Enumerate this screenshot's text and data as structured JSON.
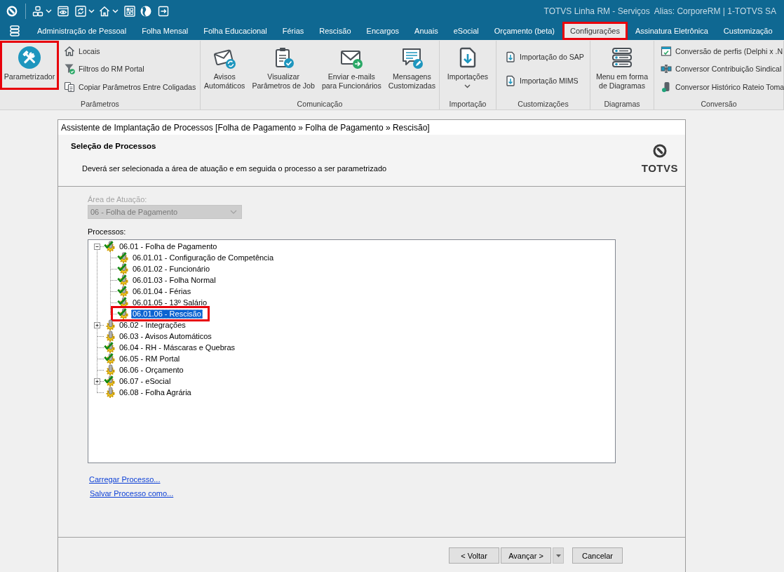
{
  "title_bar": {
    "text": "TOTVS Linha RM - Serviços  Alias: CorporeRM | 1-TOTVS SA"
  },
  "tabs": [
    {
      "label": "Administração de Pessoal",
      "selected": false,
      "highlighted": false
    },
    {
      "label": "Folha Mensal",
      "selected": false,
      "highlighted": false
    },
    {
      "label": "Folha Educacional",
      "selected": false,
      "highlighted": false
    },
    {
      "label": "Férias",
      "selected": false,
      "highlighted": false
    },
    {
      "label": "Rescisão",
      "selected": false,
      "highlighted": false
    },
    {
      "label": "Encargos",
      "selected": false,
      "highlighted": false
    },
    {
      "label": "Anuais",
      "selected": false,
      "highlighted": false
    },
    {
      "label": "eSocial",
      "selected": false,
      "highlighted": false
    },
    {
      "label": "Orçamento (beta)",
      "selected": false,
      "highlighted": false
    },
    {
      "label": "Configurações",
      "selected": true,
      "highlighted": true
    },
    {
      "label": "Assinatura Eletrônica",
      "selected": false,
      "highlighted": false
    },
    {
      "label": "Customização",
      "selected": false,
      "highlighted": false
    }
  ],
  "ribbon": {
    "groups": [
      {
        "label": "Parâmetros",
        "items": [
          {
            "kind": "large",
            "label": "Parametrizador",
            "highlighted": true
          },
          {
            "kind": "small",
            "label": "Locais",
            "highlighted": false
          },
          {
            "kind": "small",
            "label": "Filtros do RM Portal",
            "highlighted": false
          },
          {
            "kind": "small",
            "label": "Copiar Parâmetros Entre Coligadas",
            "highlighted": false
          }
        ]
      },
      {
        "label": "Comunicação",
        "items": [
          {
            "kind": "large",
            "label": "Avisos\nAutomáticos",
            "highlighted": false
          },
          {
            "kind": "large",
            "label": "Visualizar\nParâmetros de Job",
            "highlighted": false
          },
          {
            "kind": "large",
            "label": "Enviar e-mails\npara Funcionários",
            "highlighted": false
          },
          {
            "kind": "large",
            "label": "Mensagens\nCustomizadas",
            "highlighted": false
          }
        ]
      },
      {
        "label": "Importação",
        "items": [
          {
            "kind": "dropdown",
            "label": "Importações",
            "highlighted": false
          }
        ]
      },
      {
        "label": "Customizações",
        "items": [
          {
            "kind": "small",
            "label": "Importação do SAP",
            "highlighted": false
          },
          {
            "kind": "small",
            "label": "Importação MIMS",
            "highlighted": false
          }
        ]
      },
      {
        "label": "Diagramas",
        "items": [
          {
            "kind": "large",
            "label": "Menu em forma\nde Diagramas",
            "highlighted": false
          }
        ]
      },
      {
        "label": "Conversão",
        "items": [
          {
            "kind": "small",
            "label": "Conversão de perfis (Delphi x .N",
            "highlighted": false
          },
          {
            "kind": "small",
            "label": "Conversor Contribuição Sindical",
            "highlighted": false
          },
          {
            "kind": "small",
            "label": "Conversor Histórico Rateio Toma",
            "highlighted": false
          }
        ]
      }
    ]
  },
  "dialog": {
    "title": "Assistente de Implantação de Processos [Folha de Pagamento » Folha de Pagamento » Rescisão]",
    "heading": "Seleção de Processos",
    "description": "Deverá ser selecionada a área de atuação e em seguida o processo a ser parametrizado",
    "logo": "TOTVS",
    "area": {
      "label": "Área de Atuação:",
      "value": "06 - Folha de Pagamento",
      "disabled": true
    },
    "processes_label": "Processos:",
    "tree": [
      {
        "kind": "group",
        "label": "06.01 - Folha de Pagamento",
        "expanded": true,
        "checked": true,
        "selected": false,
        "highlighted": false,
        "children": [
          {
            "kind": "leaf",
            "label": "06.01.01 - Configuração de Competência",
            "checked": true,
            "selected": false,
            "highlighted": false
          },
          {
            "kind": "leaf",
            "label": "06.01.02 - Funcionário",
            "checked": true,
            "selected": false,
            "highlighted": false
          },
          {
            "kind": "leaf",
            "label": "06.01.03 - Folha Normal",
            "checked": true,
            "selected": false,
            "highlighted": false
          },
          {
            "kind": "leaf",
            "label": "06.01.04 - Férias",
            "checked": true,
            "selected": false,
            "highlighted": false
          },
          {
            "kind": "leaf",
            "label": "06.01.05 - 13º Salário",
            "checked": true,
            "selected": false,
            "highlighted": false
          },
          {
            "kind": "leaf",
            "label": "06.01.06 - Rescisão",
            "checked": true,
            "selected": true,
            "highlighted": true
          }
        ]
      },
      {
        "kind": "group",
        "label": "06.02 - Integrações",
        "expanded": false,
        "checked": false,
        "selected": false,
        "highlighted": false
      },
      {
        "kind": "leaf",
        "label": "06.03 - Avisos Automáticos",
        "checked": false,
        "selected": false,
        "highlighted": false
      },
      {
        "kind": "leaf",
        "label": "06.04 - RH - Máscaras e Quebras",
        "checked": true,
        "selected": false,
        "highlighted": false
      },
      {
        "kind": "leaf",
        "label": "06.05 - RM Portal",
        "checked": true,
        "selected": false,
        "highlighted": false
      },
      {
        "kind": "leaf",
        "label": "06.06 - Orçamento",
        "checked": false,
        "selected": false,
        "highlighted": false
      },
      {
        "kind": "group",
        "label": "06.07 - eSocial",
        "expanded": false,
        "checked": true,
        "selected": false,
        "highlighted": false
      },
      {
        "kind": "leaf",
        "label": "06.08 - Folha Agrária",
        "checked": false,
        "selected": false,
        "highlighted": false
      }
    ],
    "links": [
      "Carregar Processo...",
      "Salvar Processo como..."
    ],
    "buttons": [
      {
        "kind": "plain",
        "label": "< Voltar"
      },
      {
        "kind": "split",
        "label": "Avançar >"
      },
      {
        "kind": "plain",
        "label": "Cancelar"
      }
    ]
  }
}
